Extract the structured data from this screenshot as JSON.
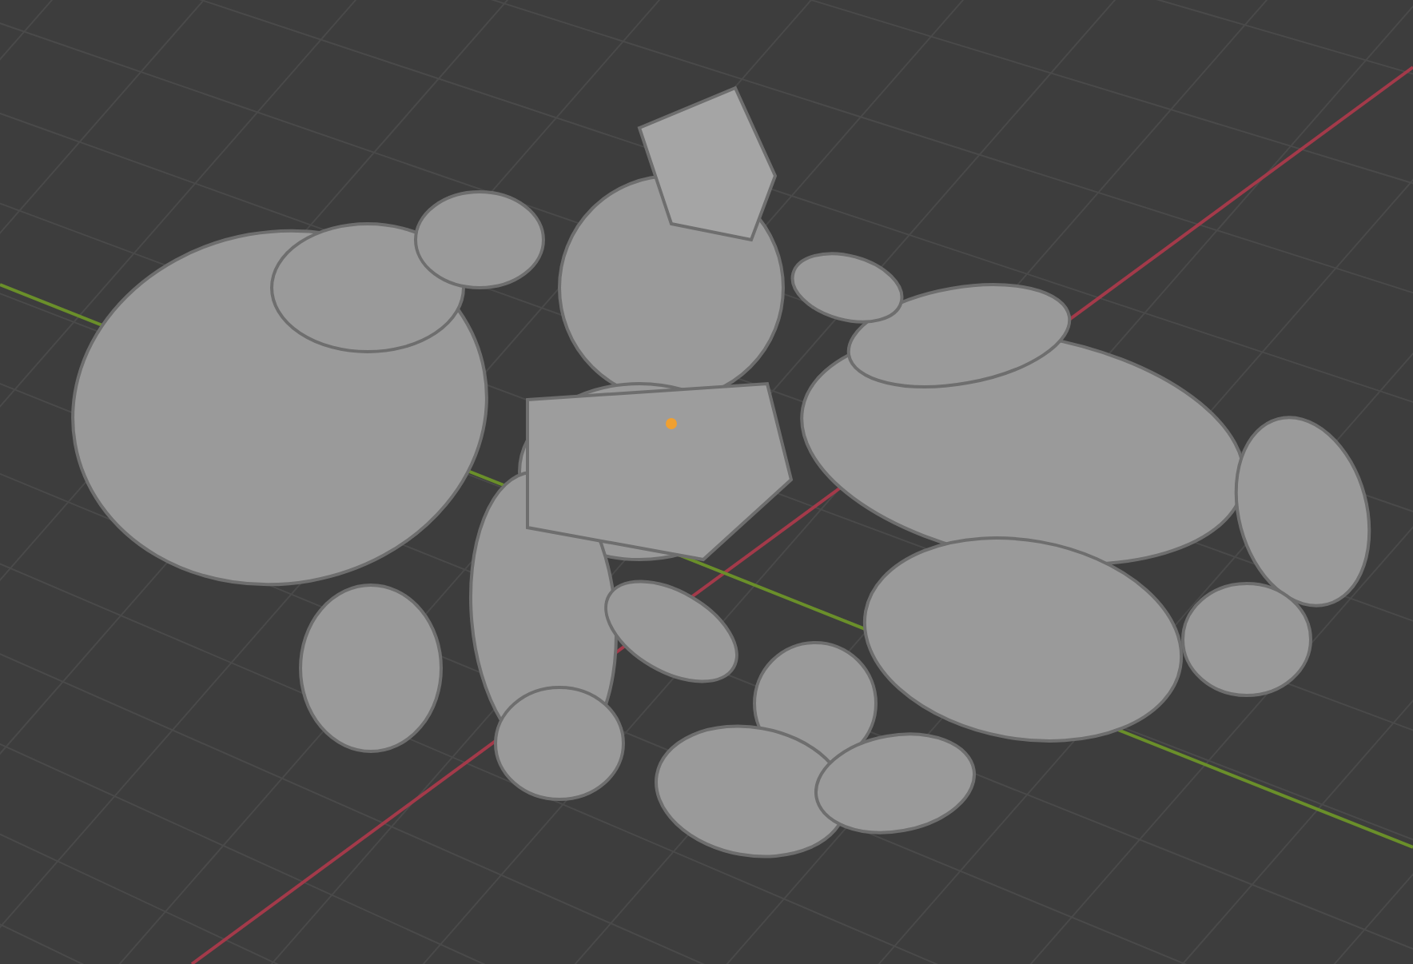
{
  "viewport": {
    "kind": "grid"
  }
}
